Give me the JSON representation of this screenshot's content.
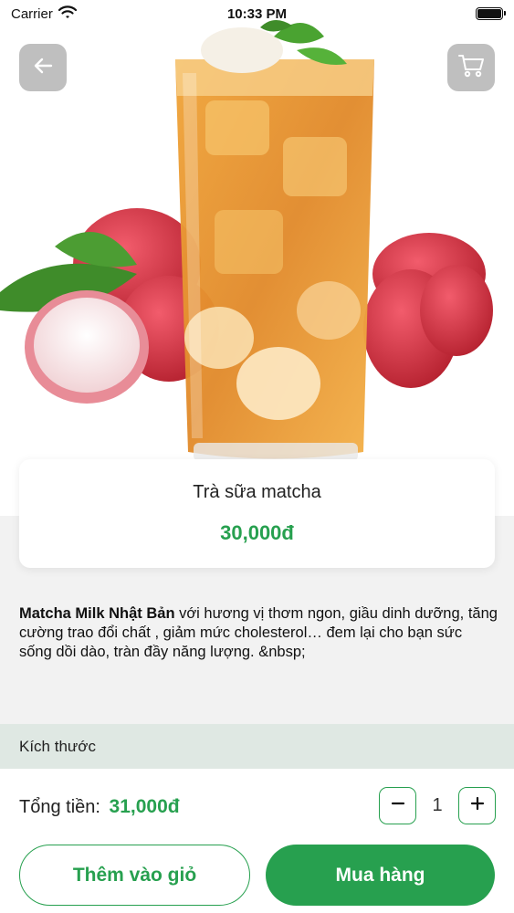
{
  "status_bar": {
    "carrier": "Carrier",
    "time": "10:33 PM"
  },
  "header": {
    "back_icon": "arrow-left-icon",
    "cart_icon": "cart-icon"
  },
  "product": {
    "name": "Trà sữa matcha",
    "price": "30,000đ"
  },
  "description": {
    "bold": "Matcha Milk Nhật Bản",
    "text": " với hương vị thơm ngon, giầu dinh dưỡng, tăng cường trao đổi chất , giảm mức cholesterol… đem lại cho bạn sức sống dồi dào, tràn đầy năng lượng. &nbsp;"
  },
  "size_section": {
    "title": "Kích thước"
  },
  "footer": {
    "total_label": "Tổng tiền:",
    "total_value": "31,000đ",
    "quantity": "1",
    "add_to_cart_label": "Thêm vào giỏ",
    "buy_label": "Mua hàng"
  },
  "colors": {
    "accent": "#27a04f",
    "size_bg": "#dfe8e3"
  }
}
